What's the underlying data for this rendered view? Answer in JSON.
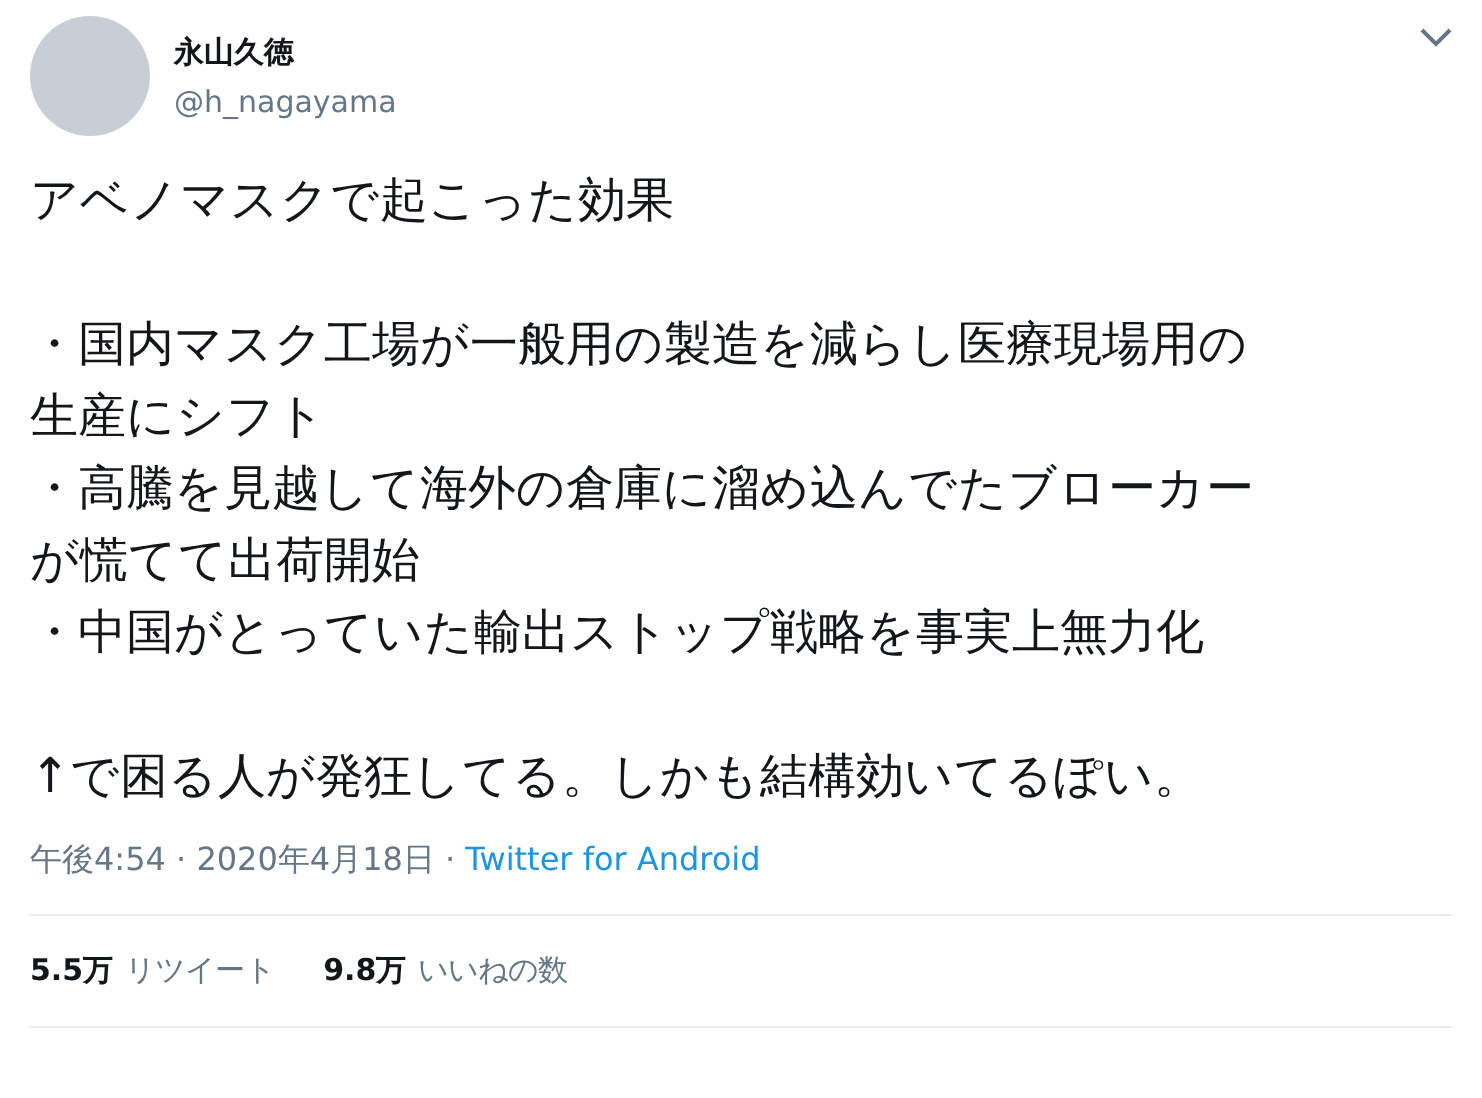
{
  "author": {
    "name": "永山久徳",
    "handle": "@h_nagayama"
  },
  "body": [
    [
      "アベノマスクで起こった効果"
    ],
    [
      "・国内マスク工場が一般用の製造を減らし医療現場用の",
      "生産にシフト",
      "・高騰を見越して海外の倉庫に溜め込んでたブローカー",
      "が慌てて出荷開始",
      "・中国がとっていた輸出ストップ戦略を事実上無力化"
    ],
    [
      "↑で困る人が発狂してる。しかも結構効いてるぽい。"
    ]
  ],
  "meta": {
    "timestamp": "午後4:54 · 2020年4月18日 ·",
    "source": "Twitter for Android"
  },
  "stats": [
    {
      "count": "5.5万",
      "label": "リツイート"
    },
    {
      "count": "9.8万",
      "label": "いいねの数"
    }
  ]
}
